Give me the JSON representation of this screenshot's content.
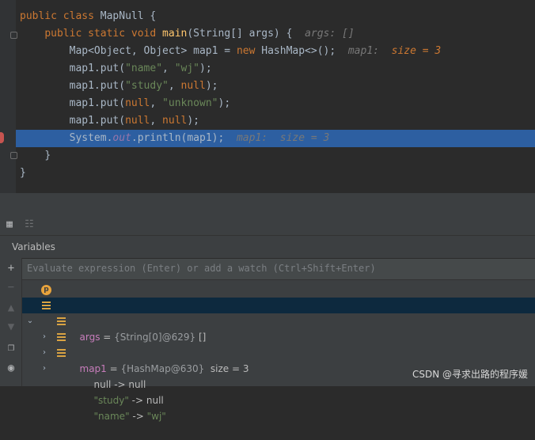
{
  "editor": {
    "class_keyword1": "public",
    "class_keyword2": "class",
    "class_name": "MapNull",
    "brace_open": " {",
    "method_mod1": "public",
    "method_mod2": "static",
    "method_type": "void",
    "method_name": "main",
    "method_params": "(String[] args) {",
    "hint_args": "args: []",
    "l3_decl": "Map<Object, Object> map1 = ",
    "l3_new": "new",
    "l3_rest": " HashMap<>();",
    "l3_hint_name": "map1:",
    "l3_hint_val": "size = 3",
    "put_prefix": "map1.put(",
    "l4_key": "\"name\"",
    "l4_val": "\"wj\"",
    "l5_key": "\"study\"",
    "l5_val": "null",
    "l6_key": "null",
    "l6_val": "\"unknown\"",
    "l7_key": "null",
    "l7_val": "null",
    "comma": ", ",
    "close_paren": ");",
    "l8_sys": "System.",
    "l8_out": "out",
    "l8_rest": ".println(map1);",
    "l8_hint_name": "map1:",
    "l8_hint_val": "size = 3",
    "close_method": "}",
    "close_class": "}"
  },
  "debug": {
    "panel_title": "Variables",
    "watch_placeholder": "Evaluate expression (Enter) or add a watch (Ctrl+Shift+Enter)",
    "badge_letter": "p",
    "vars": [
      {
        "name": "args",
        "eq": " = ",
        "type": "{String[0]@629}",
        "value": " []"
      },
      {
        "name": "map1",
        "eq": " = ",
        "type": "{HashMap@630}",
        "value": "  size = 3"
      }
    ],
    "entries": [
      {
        "key": "null",
        "arrow": " -> ",
        "value": "null"
      },
      {
        "key": "\"study\"",
        "arrow": " -> ",
        "value": "null"
      },
      {
        "key": "\"name\"",
        "arrow": " -> ",
        "value": "\"wj\""
      }
    ]
  },
  "watermark": "CSDN @寻求出路的程序媛",
  "colors": {
    "selection": "#2d5fa1",
    "keyword": "#cc7832",
    "string": "#6a8759"
  }
}
